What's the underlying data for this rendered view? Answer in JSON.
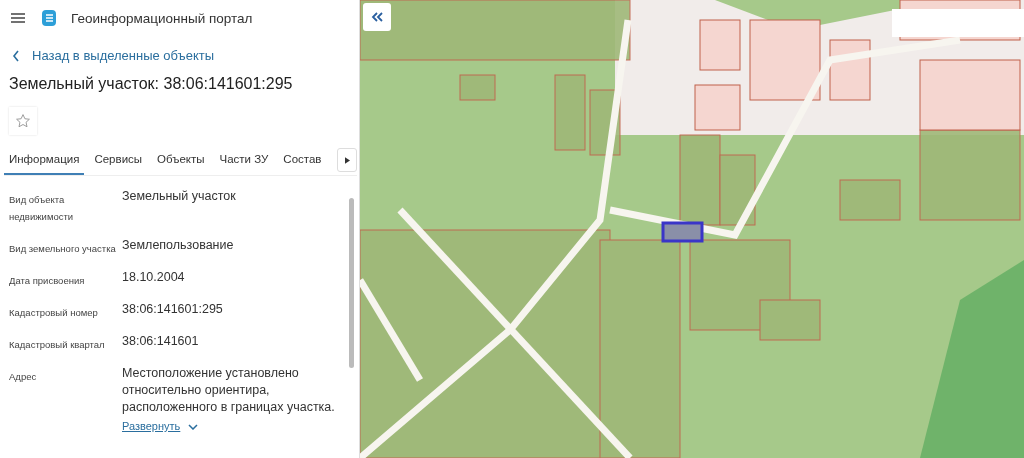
{
  "header": {
    "title": "Геоинформационный портал"
  },
  "back_link": {
    "label": "Назад в выделенные объекты"
  },
  "object_title": "Земельный участок: 38:06:141601:295",
  "favorite": {
    "selected": false
  },
  "tabs": [
    {
      "label": "Информация",
      "selected": true
    },
    {
      "label": "Сервисы",
      "selected": false
    },
    {
      "label": "Объекты",
      "selected": false
    },
    {
      "label": "Части ЗУ",
      "selected": false
    },
    {
      "label": "Состав",
      "selected": false
    }
  ],
  "properties": [
    {
      "label": "Вид объекта недвижимости",
      "value": "Земельный участок"
    },
    {
      "label": "Вид земельного участка",
      "value": "Землепользование"
    },
    {
      "label": "Дата присвоения",
      "value": "18.10.2004"
    },
    {
      "label": "Кадастровый номер",
      "value": "38:06:141601:295"
    },
    {
      "label": "Кадастровый квартал",
      "value": "38:06:141601"
    },
    {
      "label": "Адрес",
      "value": "Местоположение установлено относительно ориентира, расположенного в границах участка.",
      "expand_link": "Развернуть"
    }
  ]
}
